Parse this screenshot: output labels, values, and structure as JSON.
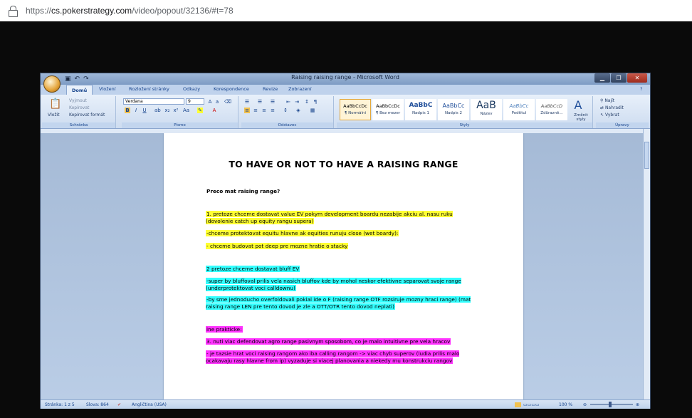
{
  "browser": {
    "url_host": "cs.pokerstrategy.com",
    "url_path": "/video/popout/32136/#t=78",
    "url_scheme": "https://"
  },
  "word": {
    "window_title": "Raising raising range - Microsoft Word",
    "tabs": [
      "Domů",
      "Vložení",
      "Rozložení stránky",
      "Odkazy",
      "Korespondence",
      "Revize",
      "Zobrazení"
    ],
    "clipboard": {
      "paste": "Vložit",
      "cut": "Vyjmout",
      "copy": "Kopírovat",
      "format_painter": "Kopírovat formát",
      "label": "Schránka"
    },
    "font": {
      "name": "Verdana",
      "size": "9",
      "label": "Písmo",
      "bold": "B",
      "italic": "I",
      "underline": "U"
    },
    "paragraph": {
      "label": "Odstavec"
    },
    "styles": {
      "label": "Styly",
      "items": [
        {
          "preview": "AaBbCcDc",
          "name": "¶ Normální"
        },
        {
          "preview": "AaBbCcDc",
          "name": "¶ Bez mezer"
        },
        {
          "preview": "AaBbC",
          "name": "Nadpis 1"
        },
        {
          "preview": "AaBbCc",
          "name": "Nadpis 2"
        },
        {
          "preview": "AaB",
          "name": "Název"
        },
        {
          "preview": "AaBbCc",
          "name": "Podtitul"
        },
        {
          "preview": "AaBbCcD",
          "name": "Zdůrazně..."
        }
      ],
      "change_styles": "Změnit styly"
    },
    "editing": {
      "find": "Najít",
      "replace": "Nahradit",
      "select": "Vybrat",
      "label": "Úpravy"
    },
    "document": {
      "title": "TO HAVE OR NOT TO HAVE A RAISING  RANGE",
      "heading": "Preco mat raising range?",
      "para1": "1. pretoze chceme dostavat value EV pokym development boardu nezabije akciu al. nasu ruku (dovolenie catch up equity rangu supera)",
      "para2": "-chceme protektovat equitu hlavne ak equities runuju close (wet boardy):",
      "para3": "- chceme budovat pot deep pre mozne hratie o stacky",
      "para4": "2 pretoze chceme dostavat bluff EV",
      "para5": "-super by bluffoval prilis vela nasich bluffov kde by mohol neskor efektivne separovat svoje range (underprotektovat voci calldownu)",
      "para6": "-by sme jednoducho overfoldovali pokial ide o F (raising range OTF rozsiruje mozny hraci range) (mat raising range LEN pre tento dovod je zle a OTT/OTR  tento dovod neplati)",
      "para7": "ine prakticke:",
      "para8": "3. nuti viac defendovat agro range pasivnym sposobom, co je malo intuitivne pre vela hracov",
      "para9": "- je tazsie hrat voci raising rangom ako iba calling rangom -> viac chyb superov (ludia prilis malo ocakavaju rasy hlavne from ip)  vyzaduje si viacej planovania a niekedy mu konstrukciu rangov"
    },
    "status": {
      "page": "Stránka: 1 z 5",
      "words": "Slova: 864",
      "language": "Angličtina (USA)",
      "zoom": "100 %"
    }
  },
  "colors": {
    "yellow_highlight": "#ffff33",
    "cyan_highlight": "#33ffff",
    "magenta_highlight": "#ff33ff",
    "ribbon_blue": "#15428b"
  }
}
